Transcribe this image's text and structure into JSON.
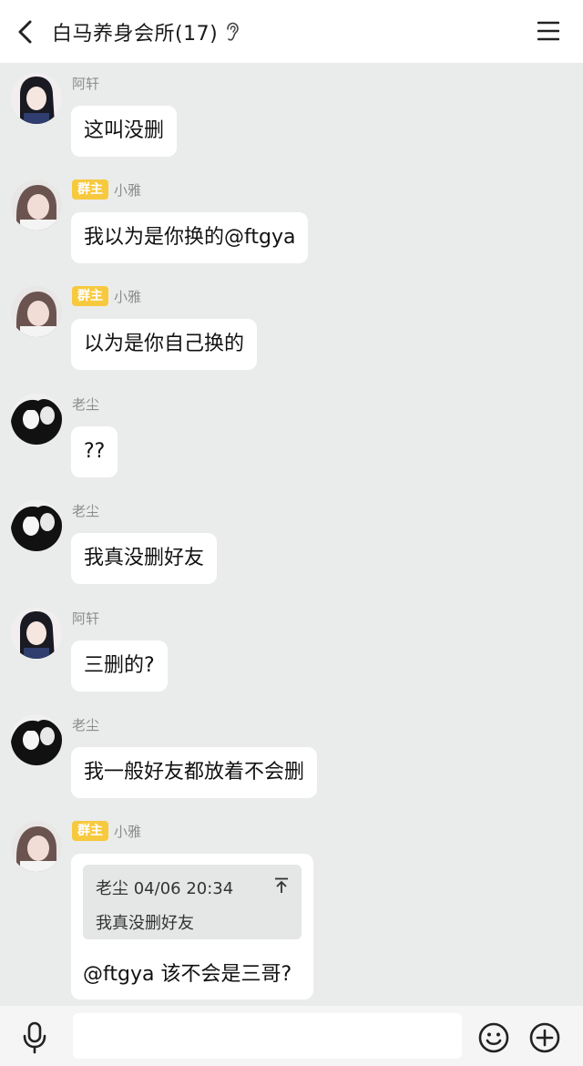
{
  "header": {
    "title": "白马养身会所(17)",
    "back_icon": "chevron-left-icon",
    "ear_icon": "ear-icon",
    "menu_icon": "hamburger-menu-icon"
  },
  "messages": [
    {
      "sender": "阿轩",
      "badge": "",
      "text": "这叫没删",
      "avatar": "avatar-axuan"
    },
    {
      "sender": "小雅",
      "badge": "群主",
      "text": "我以为是你换的@ftgya",
      "avatar": "avatar-xiaoya"
    },
    {
      "sender": "小雅",
      "badge": "群主",
      "text": "以为是你自己换的",
      "avatar": "avatar-xiaoya"
    },
    {
      "sender": "老尘",
      "badge": "",
      "text": "??",
      "avatar": "avatar-laochen"
    },
    {
      "sender": "老尘",
      "badge": "",
      "text": "我真没删好友",
      "avatar": "avatar-laochen"
    },
    {
      "sender": "阿轩",
      "badge": "",
      "text": "三删的?",
      "avatar": "avatar-axuan"
    },
    {
      "sender": "老尘",
      "badge": "",
      "text": "我一般好友都放着不会删",
      "avatar": "avatar-laochen"
    },
    {
      "sender": "小雅",
      "badge": "群主",
      "avatar": "avatar-xiaoya",
      "quote": {
        "header": "老尘 04/06 20:34",
        "text": "我真没删好友"
      },
      "text": "@ftgya 该不会是三哥?"
    }
  ],
  "input_bar": {
    "placeholder": "",
    "value": "",
    "mic_icon": "microphone-icon",
    "emoji_icon": "smiley-icon",
    "plus_icon": "plus-circle-icon"
  },
  "colors": {
    "chat_background": "#eaeceb",
    "badge": "#f7c93e",
    "bubble": "#ffffff",
    "quote_box": "#e5e6e6"
  }
}
